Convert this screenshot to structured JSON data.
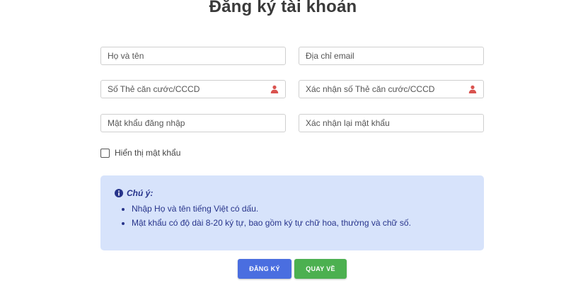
{
  "title": "Đăng ký tài khoản",
  "fields": {
    "full_name_placeholder": "Họ và tên",
    "email_placeholder": "Địa chỉ email",
    "id_card_placeholder": "Số Thẻ căn cước/CCCD",
    "id_card_confirm_placeholder": "Xác nhận số Thẻ căn cước/CCCD",
    "password_placeholder": "Mật khẩu đăng nhập",
    "password_confirm_placeholder": "Xác nhận lại mật khẩu"
  },
  "show_password": {
    "label": "Hiển thị mật khẩu",
    "checked": false
  },
  "note": {
    "title": "Chú ý:",
    "items": [
      "Nhập Họ và tên tiếng Việt có dấu.",
      "Mật khẩu có độ dài 8-20 ký tự, bao gồm ký tự chữ hoa, thường và chữ số."
    ]
  },
  "buttons": {
    "register_label": "ĐĂNG KÝ",
    "back_label": "QUAY VỀ"
  },
  "colors": {
    "note_bg": "#d7e3fb",
    "note_text": "#27348b",
    "register": "#4a6ee0",
    "back": "#4cb050",
    "user_icon": "#d9534f"
  },
  "icons": {
    "id_field_icon": "user-icon",
    "note_icon": "info-icon"
  }
}
